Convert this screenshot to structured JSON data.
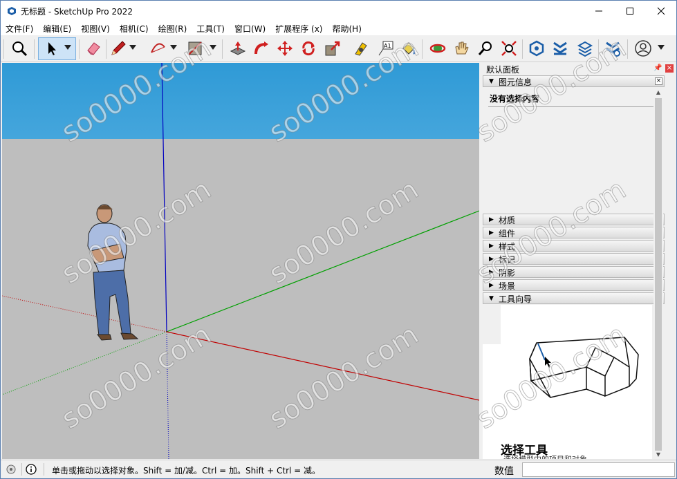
{
  "window": {
    "title": "无标题 - SketchUp Pro 2022",
    "controls": [
      "minimize-icon",
      "maximize-icon",
      "close-icon"
    ]
  },
  "menu": [
    "文件(F)",
    "编辑(E)",
    "视图(V)",
    "相机(C)",
    "绘图(R)",
    "工具(T)",
    "窗口(W)",
    "扩展程序 (x)",
    "帮助(H)"
  ],
  "toolbar": {
    "tools": [
      "zoom-icon",
      "select-icon",
      "eraser-icon",
      "pencil-icon",
      "arc-icon",
      "rectangle-icon",
      "push-pull-icon",
      "follow-me-icon",
      "move-icon",
      "rotate-icon",
      "scale-icon",
      "tape-measure-icon",
      "text-icon",
      "paint-bucket-icon",
      "orbit-icon",
      "pan-icon",
      "zoom-window-icon",
      "zoom-extents-icon",
      "warehouse-icon",
      "extension-warehouse-icon",
      "layout-icon",
      "extension-manager-icon",
      "account-icon"
    ],
    "text_tool_glyph": "A1"
  },
  "panel": {
    "title": "默认面板",
    "entity_info": {
      "label": "图元信息",
      "empty_text": "没有选择内容"
    },
    "trays": [
      "材质",
      "组件",
      "样式",
      "标记",
      "阴影",
      "场景",
      "工具向导"
    ],
    "guide": {
      "title": "选择工具",
      "description": "选择模型中的项目和对象"
    }
  },
  "status": {
    "message": "单击或拖动以选择对象。Shift = 加/减。Ctrl = 加。Shift + Ctrl = 减。",
    "measurements_label": "数值",
    "measurements_value": ""
  },
  "watermark": "so0000.com",
  "colors": {
    "sky": "#3a9fd9",
    "ground": "#bebebe",
    "axis_red": "#c00000",
    "axis_green": "#00a000",
    "axis_blue": "#0000c0",
    "close_red": "#e04040"
  }
}
